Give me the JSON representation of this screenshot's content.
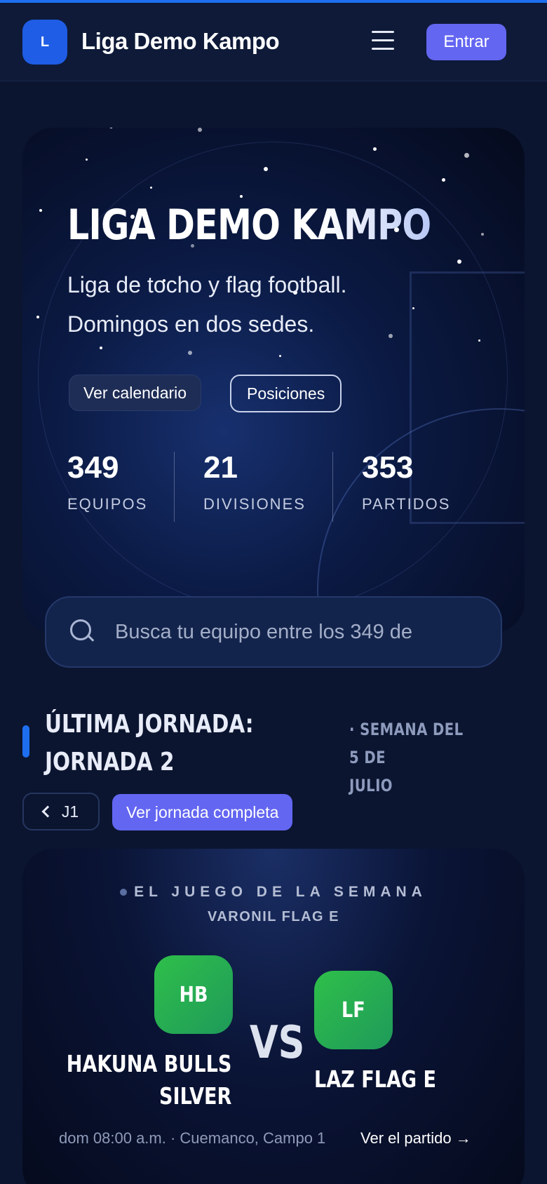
{
  "header": {
    "logo_letter": "L",
    "brand": "Liga Demo Kampo",
    "enter_label": "Entrar"
  },
  "hero": {
    "title": "LIGA DEMO KAMPO",
    "subtitle": "Liga de tocho y flag football. Domingos en dos sedes.",
    "calendar_label": "Ver calendario",
    "standings_label": "Posiciones",
    "stats": [
      {
        "value": "349",
        "label": "EQUIPOS"
      },
      {
        "value": "21",
        "label": "DIVISIONES"
      },
      {
        "value": "353",
        "label": "PARTIDOS"
      }
    ]
  },
  "search": {
    "placeholder": "Busca tu equipo entre los 349 de"
  },
  "jornada": {
    "title_line1": "ÚLTIMA JORNADA:",
    "title_line2": "JORNADA 2",
    "week_line1": "· SEMANA DEL 5 DE",
    "week_line2": "JULIO",
    "prev_label": "J1",
    "full_label": "Ver jornada completa"
  },
  "game": {
    "tag": "EL JUEGO DE LA SEMANA",
    "division": "VARONIL FLAG E",
    "home": {
      "initials": "HB",
      "name_line1": "HAKUNA BULLS",
      "name_line2": "SILVER"
    },
    "vs": "VS",
    "away": {
      "initials": "LF",
      "name": "LAZ FLAG E"
    },
    "info": "dom 08:00 a.m. · Cuemanco, Campo 1",
    "link": "Ver el partido →"
  },
  "colors": {
    "background": "#0b1530",
    "accent": "#6366f1",
    "brand_blue": "#1f5de6",
    "team_green": "#2fbf4a"
  },
  "icons": [
    "menu-icon",
    "search-icon",
    "chevron-left-icon"
  ]
}
